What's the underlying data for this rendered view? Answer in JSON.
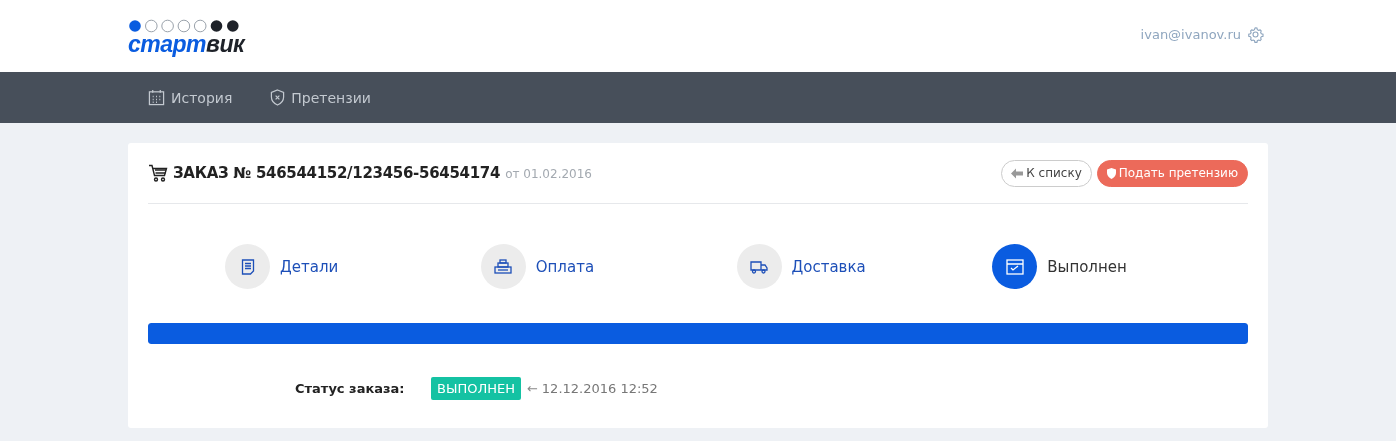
{
  "logo": {
    "parts": [
      {
        "text": "старт",
        "color": "#0a5ce0"
      },
      {
        "text": "вик",
        "color": "#1e2229"
      }
    ]
  },
  "user": {
    "email": "ivan@ivanov.ru"
  },
  "nav": [
    {
      "label": "История",
      "kind": "calendar"
    },
    {
      "label": "Претензии",
      "kind": "shield"
    }
  ],
  "order": {
    "title": "ЗАКАЗ № 546544152/123456-56454174",
    "date": "от 01.02.2016",
    "back_button": "К списку",
    "claim_button": "Подать претензию"
  },
  "steps": [
    {
      "label": "Детали",
      "kind": "details",
      "selected": false
    },
    {
      "label": "Оплата",
      "kind": "payment",
      "selected": false
    },
    {
      "label": "Доставка",
      "kind": "delivery",
      "selected": false
    },
    {
      "label": "Выполнен",
      "kind": "done",
      "selected": true
    }
  ],
  "progress": {
    "level": 1
  },
  "status": {
    "label": "Статус заказа:",
    "badge": "ВЫПОЛНЕН",
    "arrow": "←",
    "time": "12.12.2016 12:52"
  }
}
